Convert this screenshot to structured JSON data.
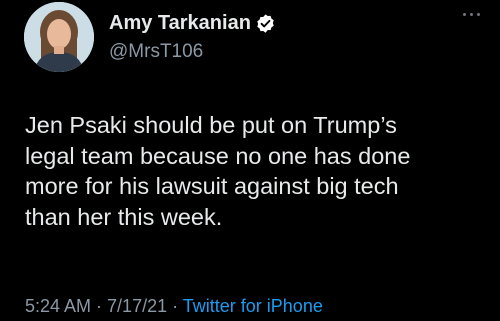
{
  "tweet": {
    "author": {
      "display_name": "Amy Tarkanian",
      "handle": "@MrsT106",
      "verified": true,
      "avatar_icon": "avatar-photo"
    },
    "more_icon": "more-options-icon",
    "text": "Jen Psaki should be put on Trump’s\nlegal team because no one has done\nmore for his lawsuit against big tech\nthan her this week.",
    "meta": {
      "time": "5:24 AM",
      "separator_1": " · ",
      "date": "7/17/21",
      "separator_2": " · ",
      "source": "Twitter for iPhone"
    }
  },
  "colors": {
    "background": "#000000",
    "text": "#e7e9ea",
    "secondary": "#8b98a5",
    "link": "#1d9bf0",
    "verified_badge": "#ffffff"
  }
}
